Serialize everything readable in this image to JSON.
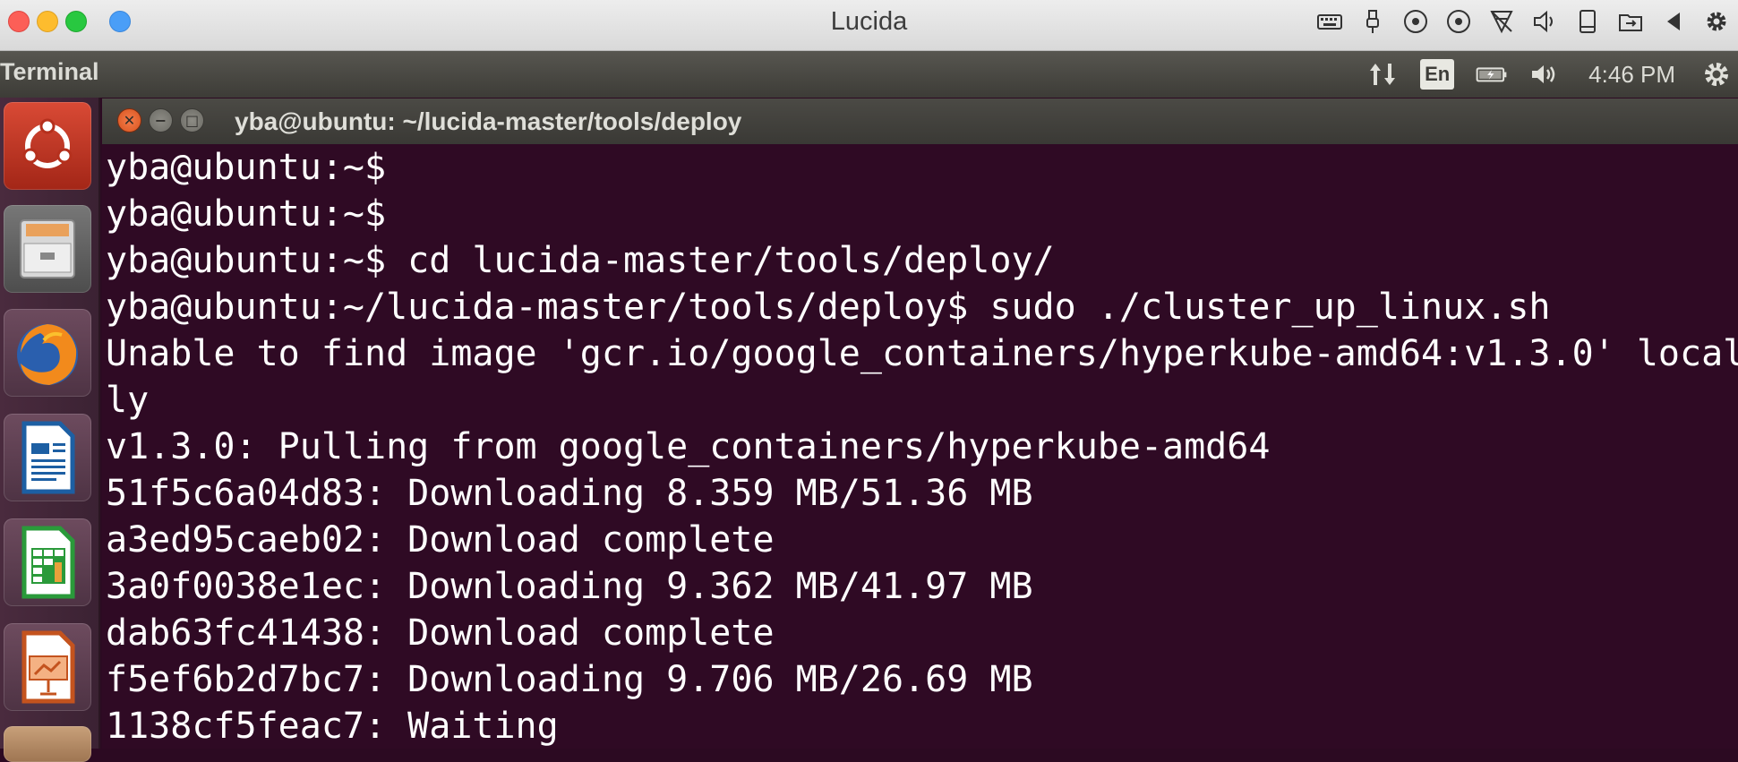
{
  "mac_window": {
    "title": "Lucida"
  },
  "mac_menubar_icons": [
    "keyboard-icon",
    "usb-icon",
    "cd-icon",
    "cd-icon",
    "network-icon",
    "audio-icon",
    "storage-icon",
    "shared-folder-icon",
    "back-arrow-icon",
    "settings-gear-icon"
  ],
  "ubuntu_panel": {
    "app_name": "Terminal",
    "language": "En",
    "time": "4:46 PM",
    "icons": [
      "network-transfer-icon",
      "battery-icon",
      "volume-icon",
      "system-gear-icon"
    ]
  },
  "launcher": {
    "items": [
      "ubuntu-dash",
      "files",
      "firefox",
      "libreoffice-writer",
      "libreoffice-calc",
      "libreoffice-impress"
    ]
  },
  "terminal": {
    "title": "yba@ubuntu: ~/lucida-master/tools/deploy",
    "lines": [
      "yba@ubuntu:~$",
      "yba@ubuntu:~$",
      "yba@ubuntu:~$ cd lucida-master/tools/deploy/",
      "yba@ubuntu:~/lucida-master/tools/deploy$ sudo ./cluster_up_linux.sh",
      "Unable to find image 'gcr.io/google_containers/hyperkube-amd64:v1.3.0' local",
      "ly",
      "v1.3.0: Pulling from google_containers/hyperkube-amd64",
      "51f5c6a04d83: Downloading 8.359 MB/51.36 MB",
      "a3ed95caeb02: Download complete",
      "3a0f0038e1ec: Downloading 9.362 MB/41.97 MB",
      "dab63fc41438: Download complete",
      "f5ef6b2d7bc7: Downloading 9.706 MB/26.69 MB",
      "1138cf5feac7: Waiting"
    ]
  },
  "colors": {
    "terminal_bg": "#2f0a24",
    "terminal_fg": "#ffffff",
    "close_orange": "#e0592a"
  }
}
